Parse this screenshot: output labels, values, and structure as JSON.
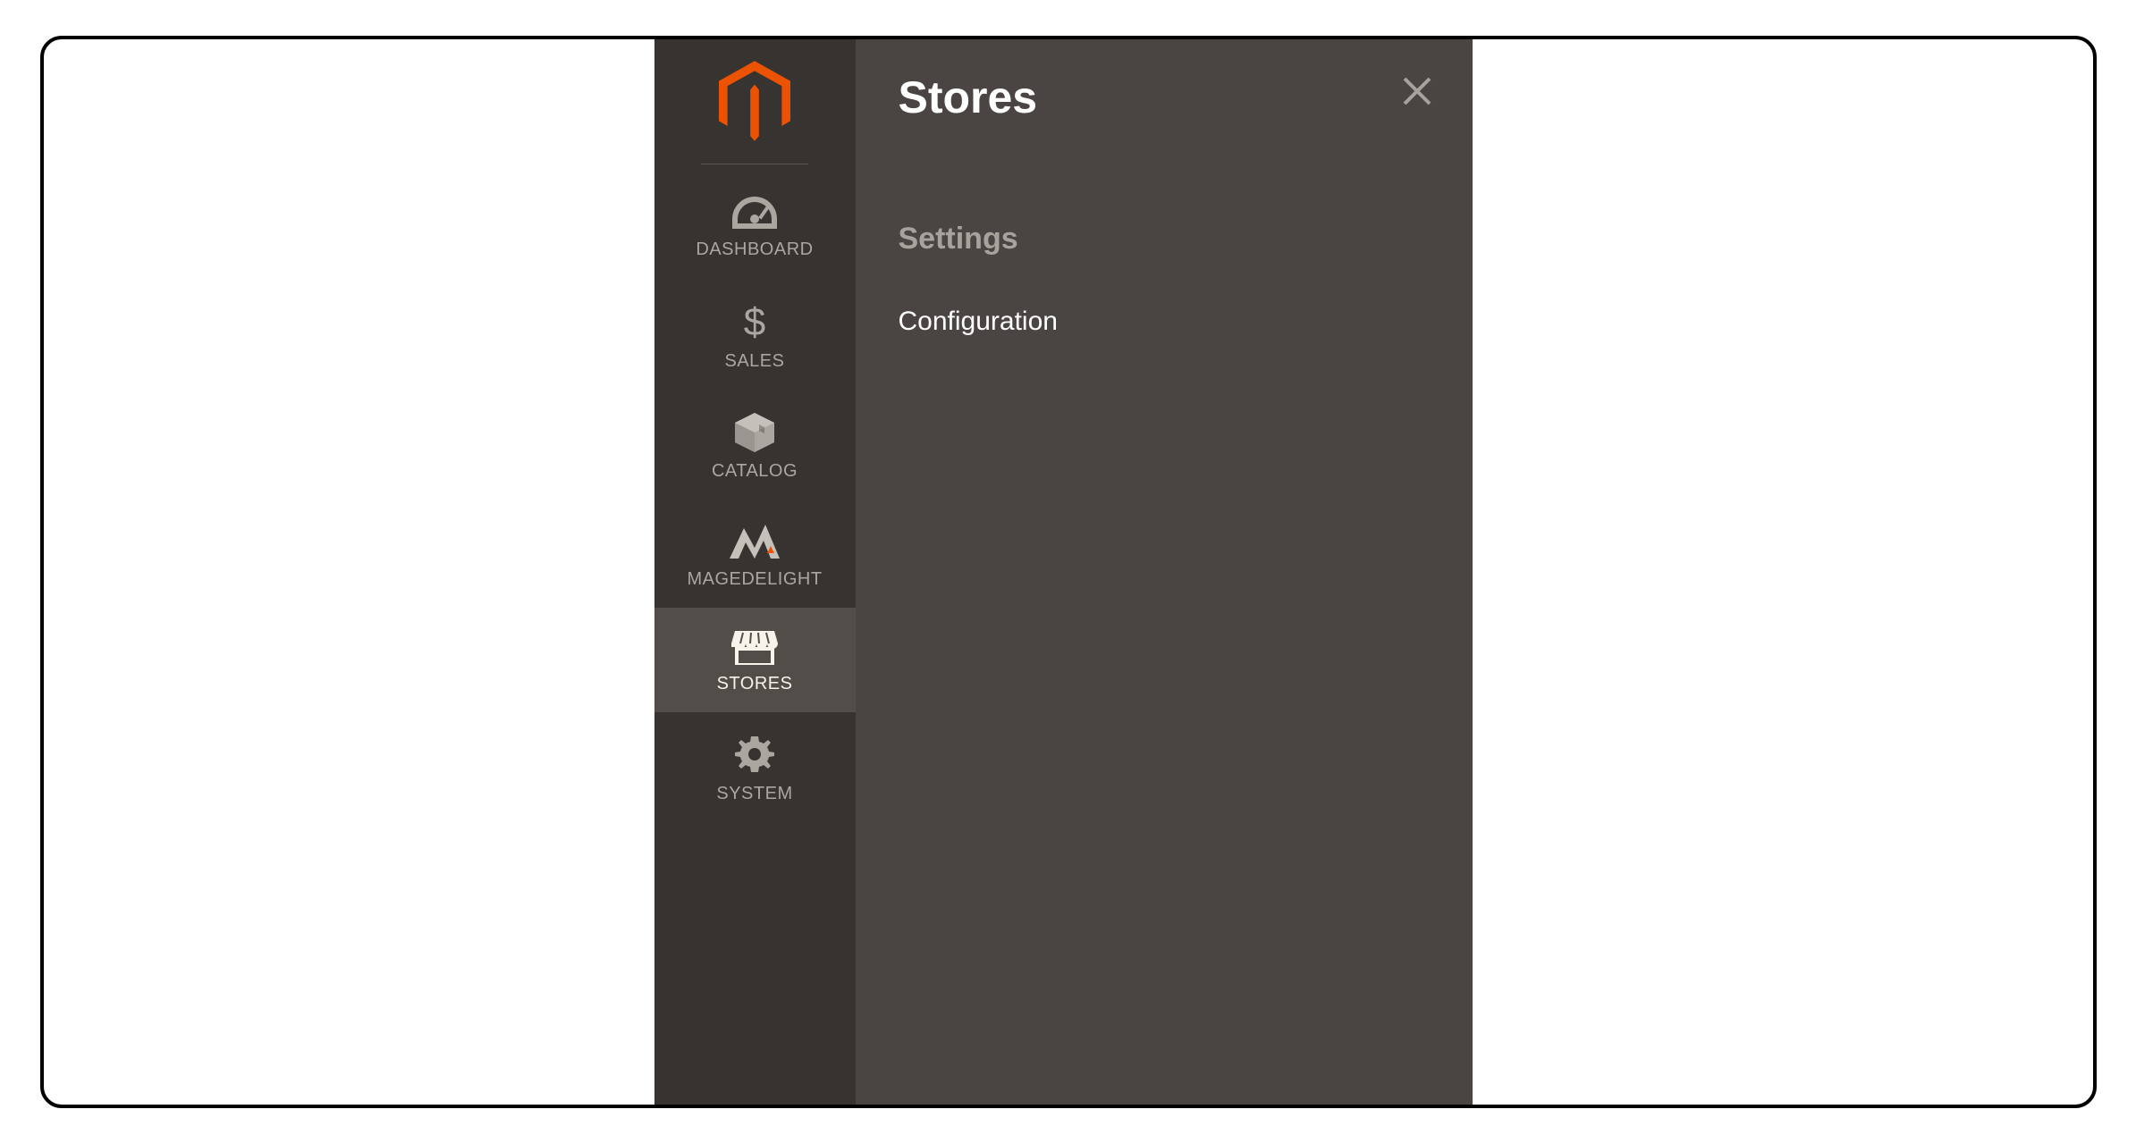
{
  "colors": {
    "accent": "#eb5202",
    "sidebar_bg": "#373330",
    "flyout_bg": "#4a4542",
    "active_bg": "#524d49",
    "muted_text": "#a7a29c"
  },
  "sidebar": {
    "items": [
      {
        "label": "DASHBOARD",
        "icon": "dashboard-icon",
        "active": false
      },
      {
        "label": "SALES",
        "icon": "dollar-icon",
        "active": false
      },
      {
        "label": "CATALOG",
        "icon": "box-icon",
        "active": false
      },
      {
        "label": "MAGEDELIGHT",
        "icon": "magedelight-icon",
        "active": false
      },
      {
        "label": "STORES",
        "icon": "storefront-icon",
        "active": true
      },
      {
        "label": "SYSTEM",
        "icon": "gear-icon",
        "active": false
      }
    ]
  },
  "flyout": {
    "title": "Stores",
    "sections": [
      {
        "heading": "Settings",
        "items": [
          {
            "label": "Configuration"
          }
        ]
      }
    ]
  }
}
